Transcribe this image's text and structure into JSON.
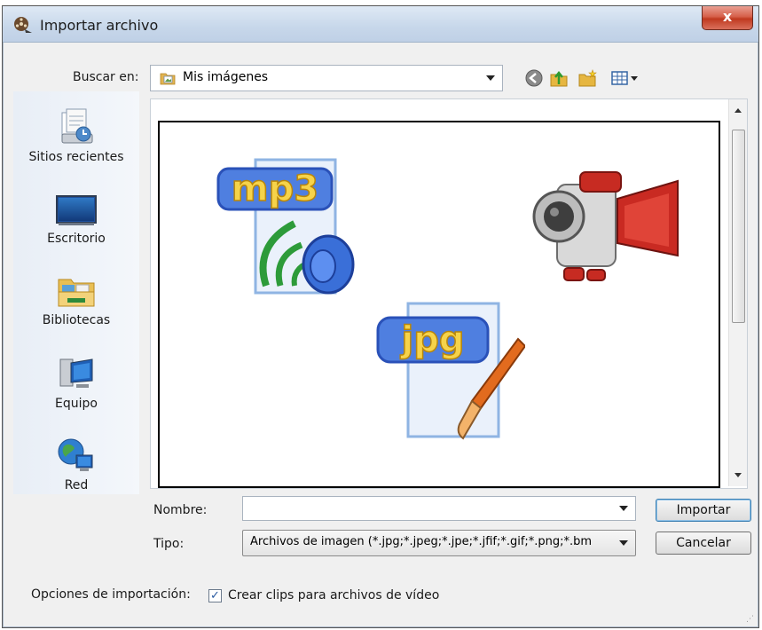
{
  "window": {
    "title": "Importar archivo",
    "close_label": "x"
  },
  "lookin": {
    "label": "Buscar en:",
    "value": "Mis imágenes"
  },
  "places": [
    {
      "label": "Sitios recientes",
      "icon": "recent-places-icon"
    },
    {
      "label": "Escritorio",
      "icon": "desktop-icon"
    },
    {
      "label": "Bibliotecas",
      "icon": "libraries-icon"
    },
    {
      "label": "Equipo",
      "icon": "computer-icon"
    },
    {
      "label": "Red",
      "icon": "network-icon"
    }
  ],
  "preview": {
    "items": [
      {
        "icon": "mp3-file-icon",
        "text": "mp3"
      },
      {
        "icon": "video-camera-icon"
      },
      {
        "icon": "jpg-file-icon",
        "text": "jpg"
      }
    ]
  },
  "filename": {
    "label": "Nombre:",
    "value": ""
  },
  "filetype": {
    "label": "Tipo:",
    "value": "Archivos de imagen (*.jpg;*.jpeg;*.jpe;*.jfif;*.gif;*.png;*.bm"
  },
  "buttons": {
    "import": "Importar",
    "cancel": "Cancelar"
  },
  "options": {
    "label": "Opciones de importación:",
    "checkbox_label": "Crear clips para archivos de vídeo",
    "checked": true
  },
  "colors": {
    "accent": "#3c7fb1",
    "close": "#c7402a"
  }
}
